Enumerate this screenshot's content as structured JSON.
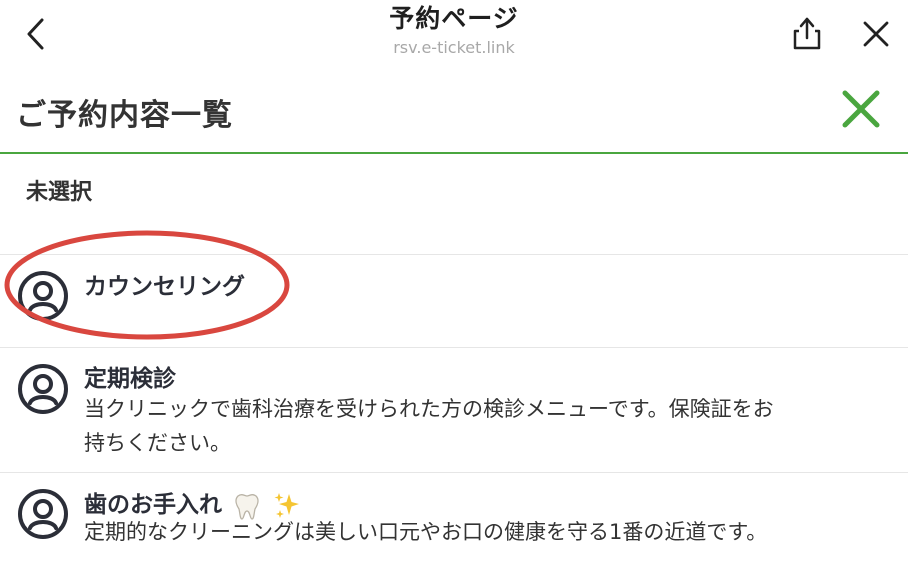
{
  "topbar": {
    "title": "予約ページ",
    "url": "rsv.e-ticket.link"
  },
  "list_header": {
    "title": "ご予約内容一覧"
  },
  "section": {
    "label": "未選択"
  },
  "menu_items": [
    {
      "name": "カウンセリング",
      "description": ""
    },
    {
      "name": "定期検診",
      "description_line1": "当クリニックで歯科治療を受けられた方の検診メニューです。保険証をお",
      "description_line2": "持ちください。"
    },
    {
      "name": "歯のお手入れ",
      "description_line1": "定期的なクリーニングは美しい口元やお口の健康を守る1番の近道です。"
    }
  ],
  "colors": {
    "accent_green": "#4aa63f",
    "annotation_red": "#d9473f",
    "text_dark": "#2b2e38"
  },
  "icons": [
    "chevron-left-icon",
    "share-icon",
    "close-icon",
    "green-x-icon",
    "user-circle-icon",
    "tooth-emoji-icon",
    "sparkles-emoji-icon"
  ]
}
